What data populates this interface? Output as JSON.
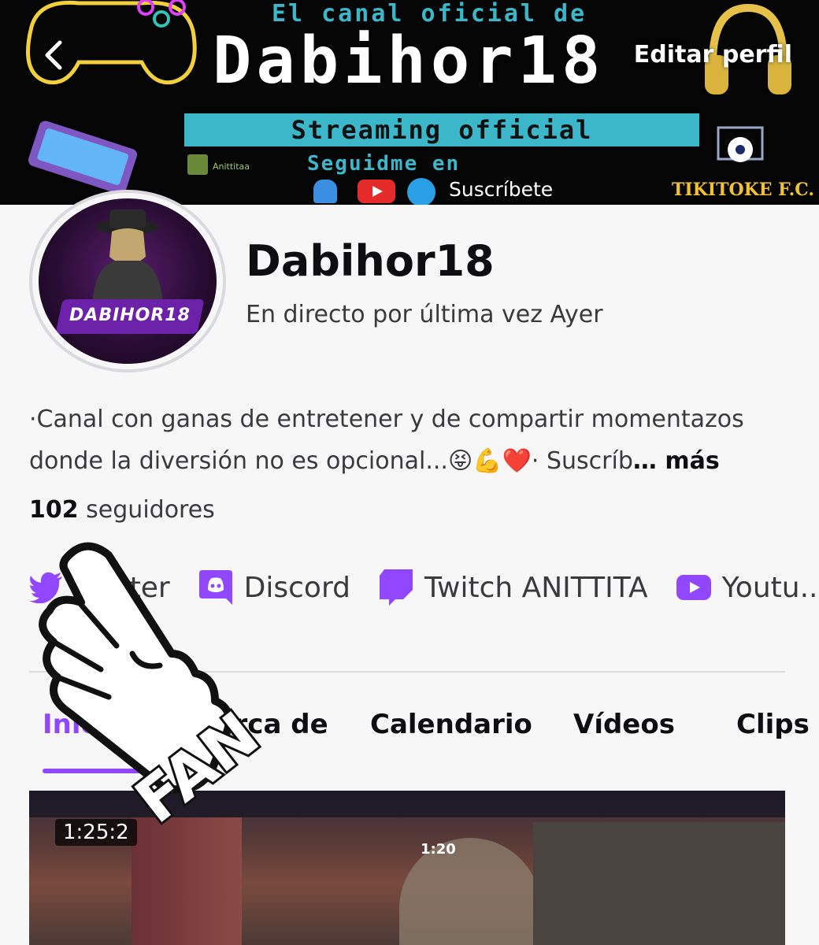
{
  "header": {
    "back_icon": "chevron-left-icon",
    "edit_label": "Editar perfil"
  },
  "banner": {
    "subtitle": "El canal oficial de",
    "channel_name": "Dabihor18",
    "strip_text": "Streaming official",
    "follow_text": "Seguidme en",
    "subscribe_text": "Suscríbete",
    "club_text": "TIKITOKE F.C.",
    "small_credit": "Anittitaa"
  },
  "profile": {
    "avatar_text": "DABIHOR18",
    "name": "Dabihor18",
    "last_live": "En directo por última vez Ayer",
    "bio": "·Canal con ganas de entretener y de compartir momentazos donde la diversión  no es opcional...😝💪❤️· Suscríb",
    "bio_more": "… más",
    "followers_count": "102",
    "followers_label": "seguidores"
  },
  "social_links": [
    {
      "icon": "twitter-icon",
      "label": "Twitter"
    },
    {
      "icon": "discord-icon",
      "label": "Discord"
    },
    {
      "icon": "twitch-icon",
      "label": "Twitch ANITTITA"
    },
    {
      "icon": "youtube-icon",
      "label": "Youtu..."
    }
  ],
  "tabs": [
    {
      "label": "Inicio",
      "active": true
    },
    {
      "label": "Acerca de",
      "active": false
    },
    {
      "label": "Calendario",
      "active": false
    },
    {
      "label": "Vídeos",
      "active": false
    },
    {
      "label": "Clips",
      "active": false
    }
  ],
  "video": {
    "duration": "1:25:2",
    "game_timer": "1:20"
  },
  "sticker": {
    "text": "FAN",
    "icon": "foam-finger-icon"
  },
  "colors": {
    "accent": "#9147ff",
    "banner_cyan": "#3cb7c9",
    "background": "#f7f7f8"
  }
}
